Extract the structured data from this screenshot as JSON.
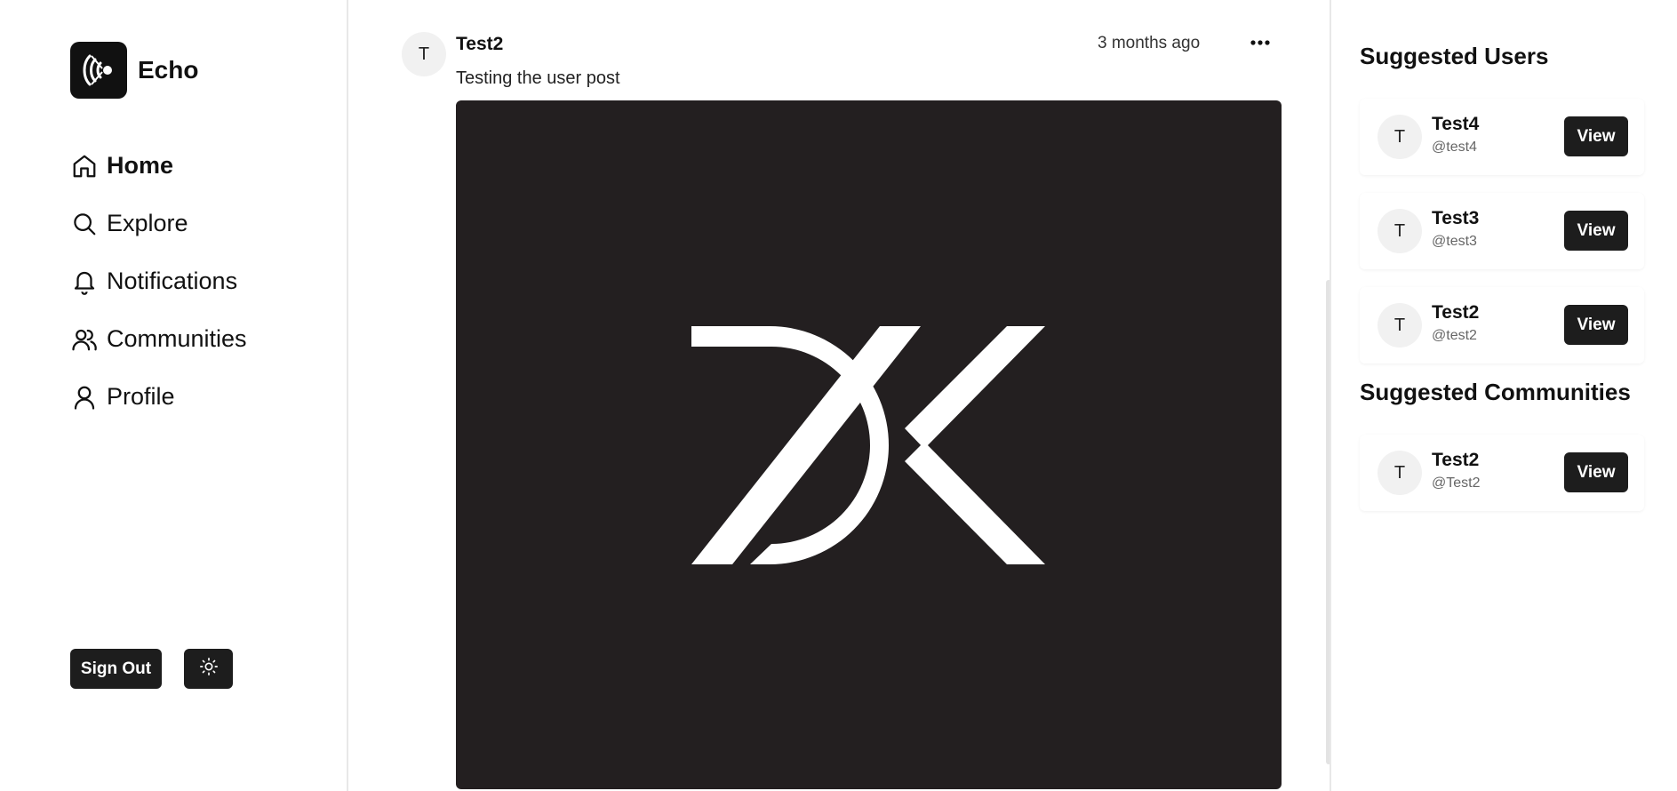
{
  "brand": {
    "name": "Echo"
  },
  "nav": {
    "items": [
      {
        "label": "Home",
        "icon": "home-icon",
        "active": true
      },
      {
        "label": "Explore",
        "icon": "search-icon"
      },
      {
        "label": "Notifications",
        "icon": "bell-icon"
      },
      {
        "label": "Communities",
        "icon": "users-icon"
      },
      {
        "label": "Profile",
        "icon": "user-icon"
      }
    ]
  },
  "sidebar": {
    "sign_out_label": "Sign Out",
    "theme_icon": "sun-icon"
  },
  "post": {
    "avatar_initial": "T",
    "author": "Test2",
    "time": "3 months ago",
    "text": "Testing the user post",
    "menu_icon": "more-horizontal-icon",
    "image_logo": "DK"
  },
  "suggested_users": {
    "title": "Suggested Users",
    "items": [
      {
        "initial": "T",
        "name": "Test4",
        "handle": "@test4",
        "button": "View"
      },
      {
        "initial": "T",
        "name": "Test3",
        "handle": "@test3",
        "button": "View"
      },
      {
        "initial": "T",
        "name": "Test2",
        "handle": "@test2",
        "button": "View"
      }
    ]
  },
  "suggested_communities": {
    "title": "Suggested Communities",
    "items": [
      {
        "initial": "T",
        "name": "Test2",
        "handle": "@Test2",
        "button": "View"
      }
    ]
  },
  "colors": {
    "dark": "#1d1d1d",
    "image_bg": "#231f20",
    "avatar_bg": "#f1f1f1",
    "divider": "#e8e8e8"
  }
}
